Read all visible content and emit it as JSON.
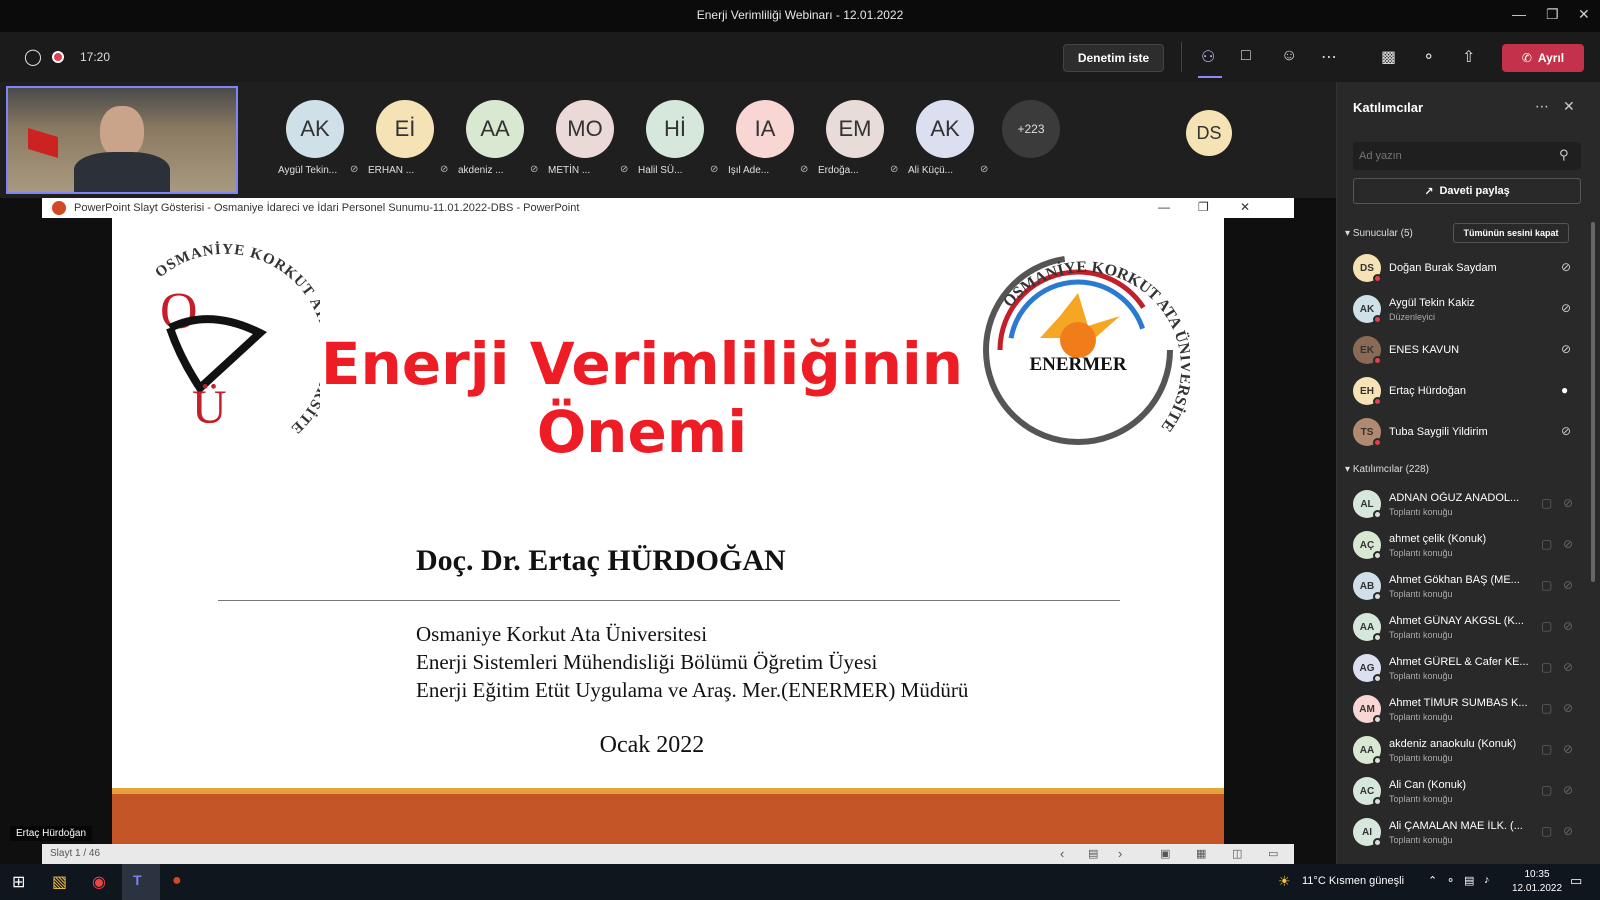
{
  "window": {
    "title": "Enerji Verimliliği Webinarı - 12.01.2022"
  },
  "toolbar": {
    "timer": "17:20",
    "request_control": "Denetim iste",
    "leave": "Ayrıl"
  },
  "participants_strip": [
    {
      "initials": "AK",
      "name": "Aygül Tekin...",
      "color": "#cfe0e8"
    },
    {
      "initials": "Eİ",
      "name": "ERHAN ...",
      "color": "#f5e3b5"
    },
    {
      "initials": "AA",
      "name": "akdeniz ...",
      "color": "#d9e8d0"
    },
    {
      "initials": "MO",
      "name": "METİN ...",
      "color": "#ead9d6"
    },
    {
      "initials": "Hİ",
      "name": "Halil SÜ...",
      "color": "#d6e8dc"
    },
    {
      "initials": "IA",
      "name": "Işıl Ade...",
      "color": "#f8d6d4"
    },
    {
      "initials": "EM",
      "name": "Erdoğa...",
      "color": "#e8dcd8"
    },
    {
      "initials": "AK",
      "name": "Ali Küçü...",
      "color": "#dcdff0"
    }
  ],
  "overflow_count": "+223",
  "self_avatar": "DS",
  "powerpoint": {
    "title": "PowerPoint Slayt Gösterisi  -  Osmaniye İdareci ve İdari Personel Sunumu-11.01.2022-DBS - PowerPoint",
    "slide_counter": "Slayt 1 / 46",
    "presenter_label": "Ertaç Hürdoğan"
  },
  "slide": {
    "logo_left_text": "OSMANİYE KORKUT ATA ÜNİVERSİTESİ",
    "logo_left_letters": "O K Ü",
    "logo_right_text": "OSMANİYE KORKUT ATA ÜNİVERSİTESİ",
    "logo_right_center": "ENERMER",
    "title_line1": "Enerji Verimliliğinin",
    "title_line2": "Önemi",
    "author": "Doç. Dr. Ertaç HÜRDOĞAN",
    "affiliation1": "Osmaniye Korkut Ata Üniversitesi",
    "affiliation2": "Enerji Sistemleri Mühendisliği Bölümü Öğretim Üyesi",
    "affiliation3": "Enerji Eğitim Etüt Uygulama ve Araş. Mer.(ENERMER) Müdürü",
    "date": "Ocak 2022"
  },
  "panel": {
    "title": "Katılımcılar",
    "search_placeholder": "Ad yazın",
    "share_invite": "Daveti paylaş",
    "presenters_header": "Sunucular (5)",
    "mute_all": "Tümünün sesini kapat",
    "presenters": [
      {
        "initials": "DS",
        "name": "Doğan Burak Saydam",
        "sub": "",
        "color": "#f5e3b5",
        "mic": "muted"
      },
      {
        "initials": "AK",
        "name": "Aygül Tekin Kakiz",
        "sub": "Düzenleyici",
        "color": "#cfe0e8",
        "mic": "muted"
      },
      {
        "initials": "EK",
        "name": "ENES KAVUN",
        "sub": "",
        "color": "#8a6a55",
        "mic": "muted"
      },
      {
        "initials": "EH",
        "name": "Ertaç Hürdoğan",
        "sub": "",
        "color": "#f5e3b5",
        "mic": "on"
      },
      {
        "initials": "TS",
        "name": "Tuba Saygili Yildirim",
        "sub": "",
        "color": "#b08a70",
        "mic": "muted"
      }
    ],
    "attendees_header": "Katılımcılar (228)",
    "attendees": [
      {
        "initials": "AL",
        "name": "ADNAN OĞUZ ANADOL...",
        "sub": "Toplantı konuğu",
        "color": "#d6e8dc"
      },
      {
        "initials": "AÇ",
        "name": "ahmet çelik (Konuk)",
        "sub": "Toplantı konuğu",
        "color": "#d9e8d0"
      },
      {
        "initials": "AB",
        "name": "Ahmet Gökhan BAŞ (ME...",
        "sub": "Toplantı konuğu",
        "color": "#cfe0e8"
      },
      {
        "initials": "AA",
        "name": "Ahmet GÜNAY AKGSL (K...",
        "sub": "Toplantı konuğu",
        "color": "#d6e8dc"
      },
      {
        "initials": "AG",
        "name": "Ahmet GÜREL & Cafer KE...",
        "sub": "Toplantı konuğu",
        "color": "#dcdff0"
      },
      {
        "initials": "AM",
        "name": "Ahmet TİMUR SUMBAS K...",
        "sub": "Toplantı konuğu",
        "color": "#f8d6d4"
      },
      {
        "initials": "AA",
        "name": "akdeniz anaokulu (Konuk)",
        "sub": "Toplantı konuğu",
        "color": "#d9e8d0"
      },
      {
        "initials": "AC",
        "name": "Ali Can (Konuk)",
        "sub": "Toplantı konuğu",
        "color": "#d6e8dc"
      },
      {
        "initials": "AI",
        "name": "Ali ÇAMALAN MAE İLK. (...",
        "sub": "Toplantı konuğu",
        "color": "#d6e8dc"
      }
    ]
  },
  "taskbar": {
    "weather": "11°C  Kısmen güneşli",
    "time": "10:35",
    "date": "12.01.2022"
  }
}
